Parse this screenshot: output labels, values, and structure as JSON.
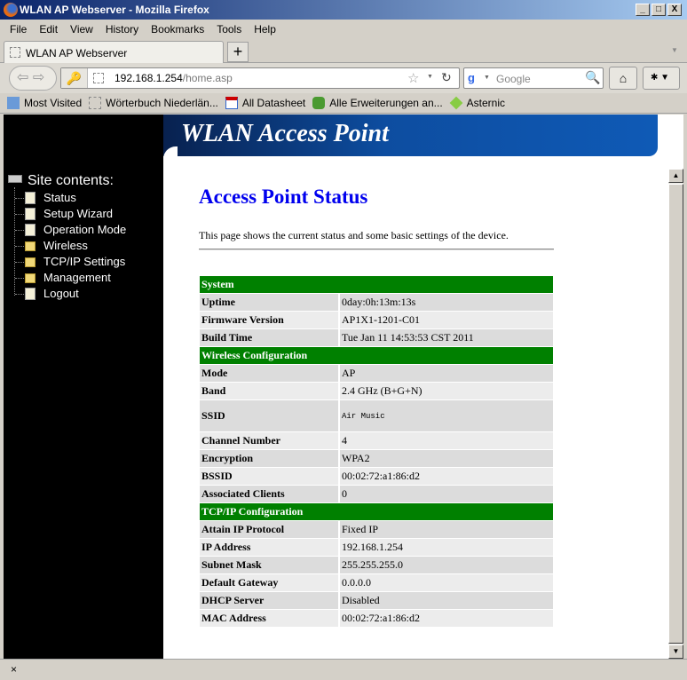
{
  "window": {
    "title": "WLAN AP Webserver - Mozilla Firefox",
    "controls": [
      "_",
      "□",
      "X"
    ]
  },
  "menu": [
    "File",
    "Edit",
    "View",
    "History",
    "Bookmarks",
    "Tools",
    "Help"
  ],
  "tab": {
    "label": "WLAN AP Webserver",
    "new_tab": "+"
  },
  "nav": {
    "url_host": "192.168.1.254",
    "url_path": "/home.asp",
    "search_placeholder": "Google"
  },
  "bookmarks": [
    "Most Visited",
    "Wörterbuch Niederlän...",
    "All Datasheet",
    "Alle Erweiterungen an...",
    "Asternic"
  ],
  "sidebar": {
    "title": "Site contents:",
    "items": [
      {
        "label": "Status",
        "icon": "document"
      },
      {
        "label": "Setup Wizard",
        "icon": "document"
      },
      {
        "label": "Operation Mode",
        "icon": "document"
      },
      {
        "label": "Wireless",
        "icon": "folder"
      },
      {
        "label": "TCP/IP Settings",
        "icon": "folder"
      },
      {
        "label": "Management",
        "icon": "folder"
      },
      {
        "label": "Logout",
        "icon": "document"
      }
    ]
  },
  "banner": {
    "title": "WLAN Access Point"
  },
  "page": {
    "title": "Access Point Status",
    "description": "This page shows the current status and some basic settings of the device."
  },
  "table": [
    {
      "section": "System"
    },
    {
      "label": "Uptime",
      "value": "0day:0h:13m:13s"
    },
    {
      "label": "Firmware Version",
      "value": "AP1X1-1201-C01"
    },
    {
      "label": "Build Time",
      "value": "Tue Jan 11 14:53:53 CST 2011"
    },
    {
      "section": "Wireless Configuration"
    },
    {
      "label": "Mode",
      "value": "AP"
    },
    {
      "label": "Band",
      "value": "2.4 GHz (B+G+N)"
    },
    {
      "label": "SSID",
      "value": "Air Music",
      "mono": true
    },
    {
      "label": "Channel Number",
      "value": "4"
    },
    {
      "label": "Encryption",
      "value": "WPA2"
    },
    {
      "label": "BSSID",
      "value": "00:02:72:a1:86:d2"
    },
    {
      "label": "Associated Clients",
      "value": "0"
    },
    {
      "section": "TCP/IP Configuration"
    },
    {
      "label": "Attain IP Protocol",
      "value": "Fixed IP"
    },
    {
      "label": "IP Address",
      "value": "192.168.1.254"
    },
    {
      "label": "Subnet Mask",
      "value": "255.255.255.0"
    },
    {
      "label": "Default Gateway",
      "value": "0.0.0.0"
    },
    {
      "label": "DHCP Server",
      "value": "Disabled"
    },
    {
      "label": "MAC Address",
      "value": "00:02:72:a1:86:d2"
    }
  ],
  "statusbar": {
    "close": "×"
  },
  "colors": {
    "section_header": "#008000",
    "page_title": "#0000ee",
    "sidebar_bg": "#000000"
  }
}
